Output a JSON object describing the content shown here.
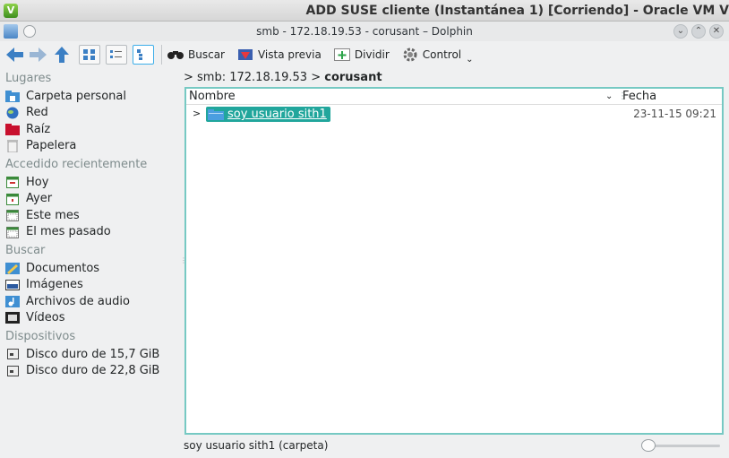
{
  "vbox": {
    "title": "ADD SUSE cliente (Instantánea 1) [Corriendo] - Oracle VM V"
  },
  "window": {
    "title": "smb - 172.18.19.53 - corusant – Dolphin"
  },
  "toolbar": {
    "search_label": "Buscar",
    "preview_label": "Vista previa",
    "split_label": "Dividir",
    "control_label": "Control"
  },
  "sidebar": {
    "places_header": "Lugares",
    "places": [
      "Carpeta personal",
      "Red",
      "Raíz",
      "Papelera"
    ],
    "recent_header": "Accedido recientemente",
    "recent": [
      "Hoy",
      "Ayer",
      "Este mes",
      "El mes pasado"
    ],
    "search_header": "Buscar",
    "search": [
      "Documentos",
      "Imágenes",
      "Archivos de audio",
      "Vídeos"
    ],
    "devices_header": "Dispositivos",
    "devices": [
      "Disco duro de 15,7 GiB",
      "Disco duro de 22,8 GiB"
    ]
  },
  "breadcrumb": {
    "root": "smb: 172.18.19.53",
    "current": "corusant"
  },
  "columns": {
    "name": "Nombre",
    "date": "Fecha"
  },
  "files": [
    {
      "name": "soy usuario sith1",
      "date": "23-11-15 09:21"
    }
  ],
  "status": {
    "text": "soy usuario sith1 (carpeta)"
  },
  "colors": {
    "selection": "#21a69c",
    "view_border": "#76c9c3",
    "accent": "#3daee9"
  }
}
